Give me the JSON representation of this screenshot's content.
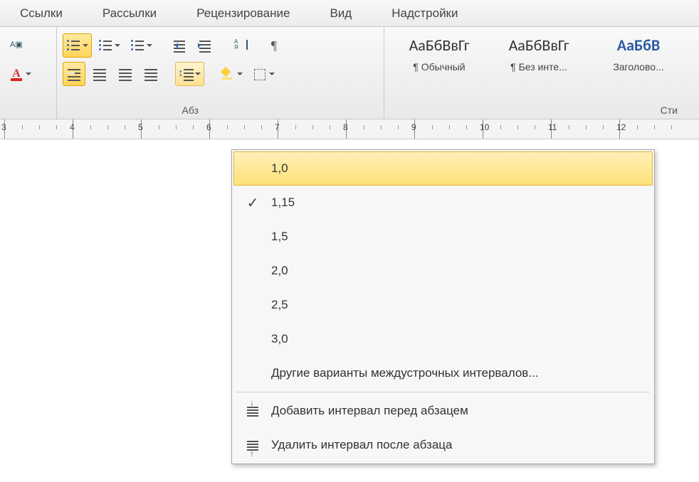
{
  "tabs": {
    "links": "Ссылки",
    "mailings": "Рассылки",
    "review": "Рецензирование",
    "view": "Вид",
    "addins": "Надстройки"
  },
  "paragraph_group_label": "Абз",
  "styles_group_label": "Сти",
  "styles": [
    {
      "sample": "АаБбВвГг",
      "name": "¶ Обычный",
      "blue": false
    },
    {
      "sample": "АаБбВвГг",
      "name": "¶ Без инте...",
      "blue": false
    },
    {
      "sample": "АаБбВ",
      "name": "Заголово...",
      "blue": true
    }
  ],
  "ruler": [
    "3",
    "4",
    "5",
    "6",
    "7",
    "8",
    "9",
    "10",
    "11",
    "12"
  ],
  "line_spacing_menu": {
    "options": [
      "1,0",
      "1,15",
      "1,5",
      "2,0",
      "2,5",
      "3,0"
    ],
    "selected_index": 1,
    "hover_index": 0,
    "more": "Другие варианты междустрочных интервалов...",
    "add_before": "Добавить интервал перед абзацем",
    "remove_after": "Удалить интервал после абзаца"
  },
  "icons": {
    "pilcrow": "¶",
    "font_color_glyph": "A"
  }
}
